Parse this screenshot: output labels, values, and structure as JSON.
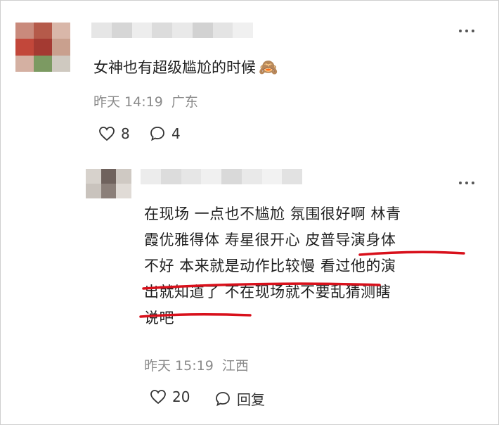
{
  "comment1": {
    "text": "女神也有超级尴尬的时候",
    "emoji": "🙈",
    "time": "昨天 14:19",
    "location": "广东",
    "likes": "8",
    "replies": "4"
  },
  "comment2": {
    "lines": [
      "在现场 一点也不尴尬 氛围很好啊 林青",
      "霞优雅得体 寿星很开心 皮普导演身体",
      "不好 本来就是动作比较慢 看过他的演",
      "出就知道了 不在现场就不要乱猜测瞎",
      "说吧"
    ],
    "time": "昨天 15:19",
    "location": "江西",
    "likes": "20",
    "reply_label": "回复"
  },
  "colors": {
    "underline": "#d8101b",
    "meta": "#8a8a8a"
  },
  "icons": [
    "heart-icon",
    "comment-bubble-icon",
    "more-options-icon"
  ]
}
